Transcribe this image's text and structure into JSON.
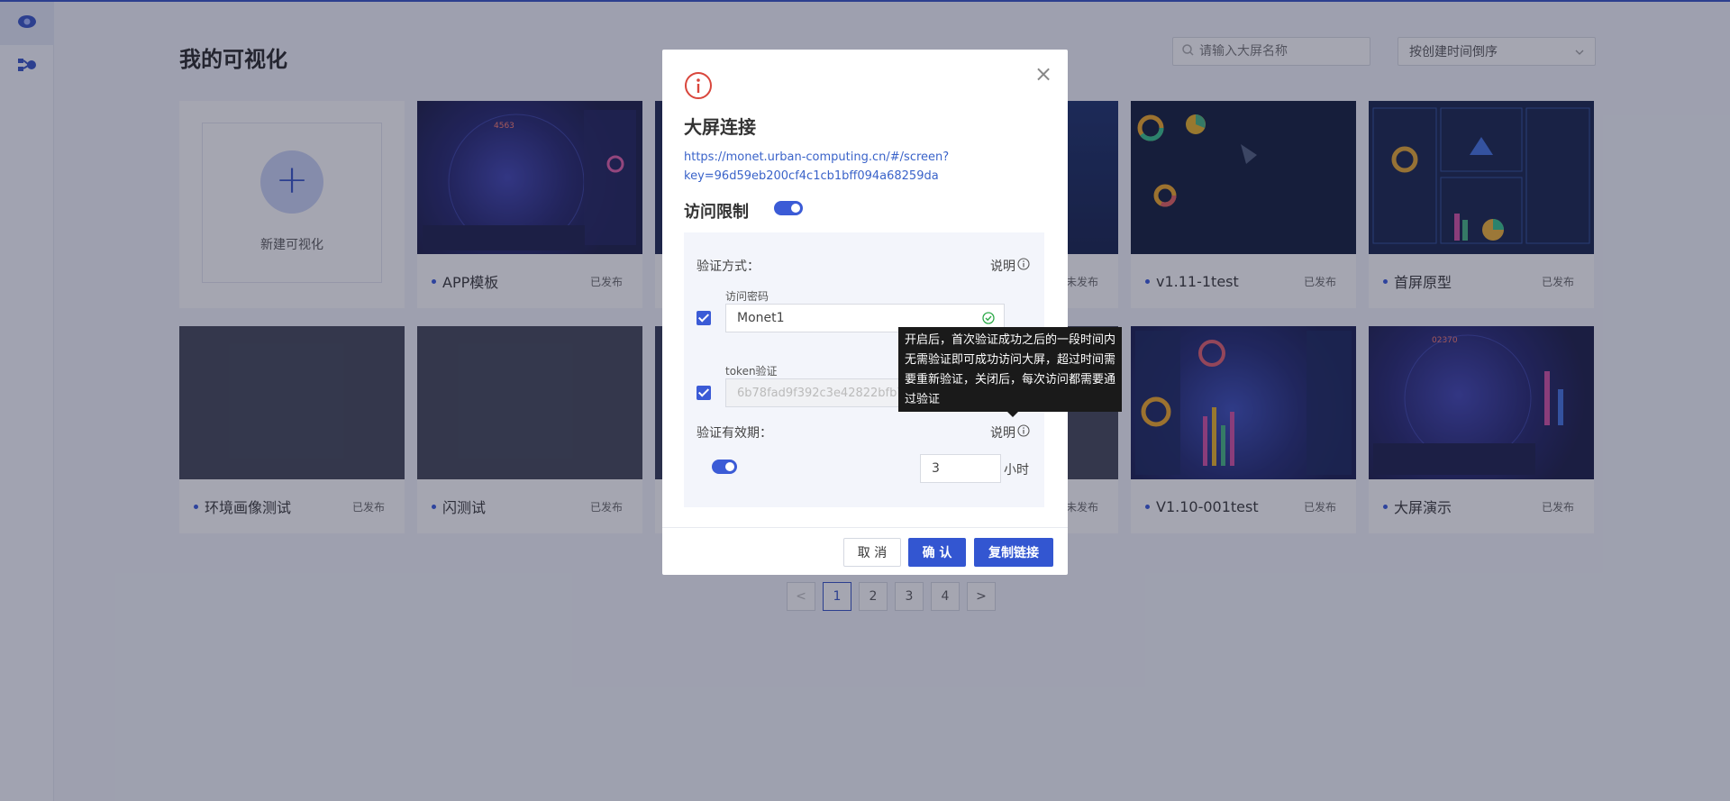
{
  "sidebar": {
    "items": [
      {
        "icon": "eye-icon"
      },
      {
        "icon": "flow-icon"
      }
    ]
  },
  "page": {
    "title": "我的可视化",
    "search_placeholder": "请输入大屏名称",
    "sort_value": "按创建时间倒序",
    "new_label": "新建可视化"
  },
  "cards": [
    {
      "name": "APP模板",
      "status": "已发布"
    },
    {
      "name": "",
      "status": "未发布"
    },
    {
      "name": "v1.11-1test",
      "status": "已发布"
    },
    {
      "name": "首屏原型",
      "status": "已发布"
    },
    {
      "name": "环境画像测试",
      "status": "已发布"
    },
    {
      "name": "闪测试",
      "status": "已发布"
    },
    {
      "name": "",
      "status": "未发布"
    },
    {
      "name": "V1.10-001test",
      "status": "已发布"
    },
    {
      "name": "大屏演示",
      "status": "已发布"
    }
  ],
  "pagination": {
    "prev": "<",
    "pages": [
      "1",
      "2",
      "3",
      "4"
    ],
    "next": ">",
    "current": "1"
  },
  "modal": {
    "title": "大屏连接",
    "link": "https://monet.urban-computing.cn/#/screen?key=96d59eb200cf4c1cb1bff094a68259da",
    "access_label": "访问限制",
    "verify_method_label": "验证方式：",
    "explain_label": "说明",
    "password_label": "访问密码",
    "password_value": "Monet1",
    "token_label": "token验证",
    "token_value": "6b78fad9f392c3e42822bfb7c",
    "validity_label": "验证有效期：",
    "hours_value": "3",
    "hours_unit": "小时",
    "cancel": "取 消",
    "confirm": "确 认",
    "copy": "复制链接",
    "close": "×"
  },
  "tooltip": {
    "text": "开启后，首次验证成功之后的一段时间内无需验证即可成功访问大屏，超过时间需要重新验证，关闭后，每次访问都需要通过验证"
  },
  "colors": {
    "primary": "#3356d1",
    "link": "#3a63c9",
    "danger": "#d9463c",
    "success": "#2eaa4a"
  }
}
